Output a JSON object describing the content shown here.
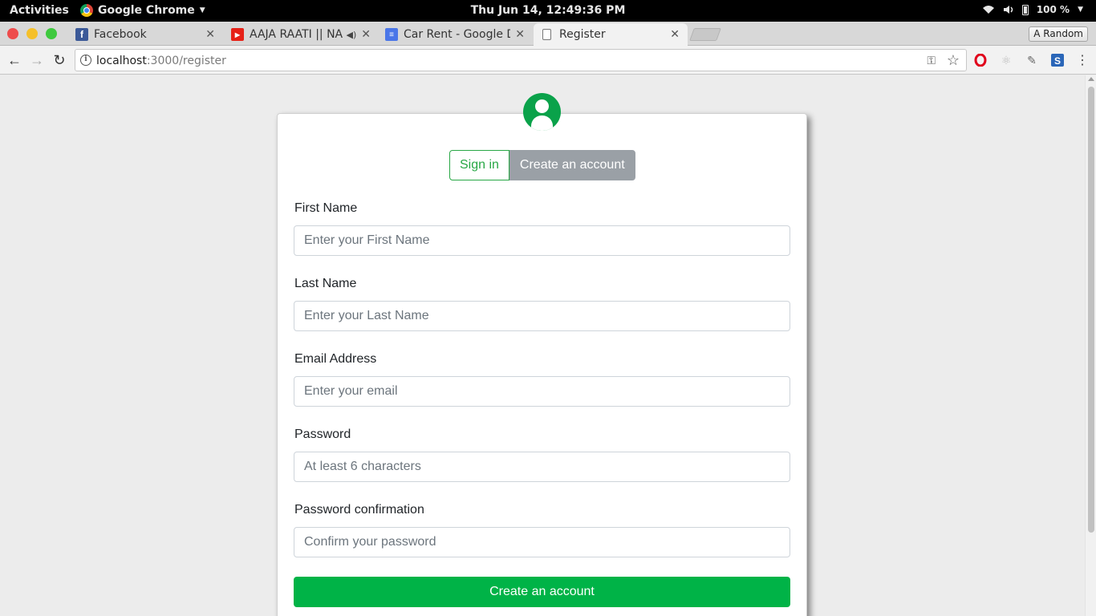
{
  "system_bar": {
    "activities": "Activities",
    "app_name": "Google Chrome",
    "clock": "Thu Jun 14, 12:49:36 PM",
    "battery": "100 %"
  },
  "browser": {
    "tabs": [
      {
        "label": "Facebook",
        "favicon": "facebook-icon"
      },
      {
        "label": "AAJA RAATI || NA",
        "favicon": "youtube-icon",
        "audio": true
      },
      {
        "label": "Car Rent - Google Do",
        "favicon": "google-docs-icon"
      },
      {
        "label": "Register",
        "favicon": "page-icon",
        "active": true
      }
    ],
    "profile_button": "A Random",
    "url_host": "localhost",
    "url_path": ":3000/register"
  },
  "form": {
    "signin_tab": "Sign in",
    "create_tab": "Create an account",
    "fields": [
      {
        "label": "First Name",
        "placeholder": "Enter your First Name"
      },
      {
        "label": "Last Name",
        "placeholder": "Enter your Last Name"
      },
      {
        "label": "Email Address",
        "placeholder": "Enter your email"
      },
      {
        "label": "Password",
        "placeholder": "At least 6 characters"
      },
      {
        "label": "Password confirmation",
        "placeholder": "Confirm your password"
      }
    ],
    "submit_label": "Create an account"
  },
  "colors": {
    "accent_green": "#28a745",
    "submit_green": "#00b347",
    "avatar_green": "#0aa24a",
    "inactive_tab_gray": "#9aa0a6"
  }
}
